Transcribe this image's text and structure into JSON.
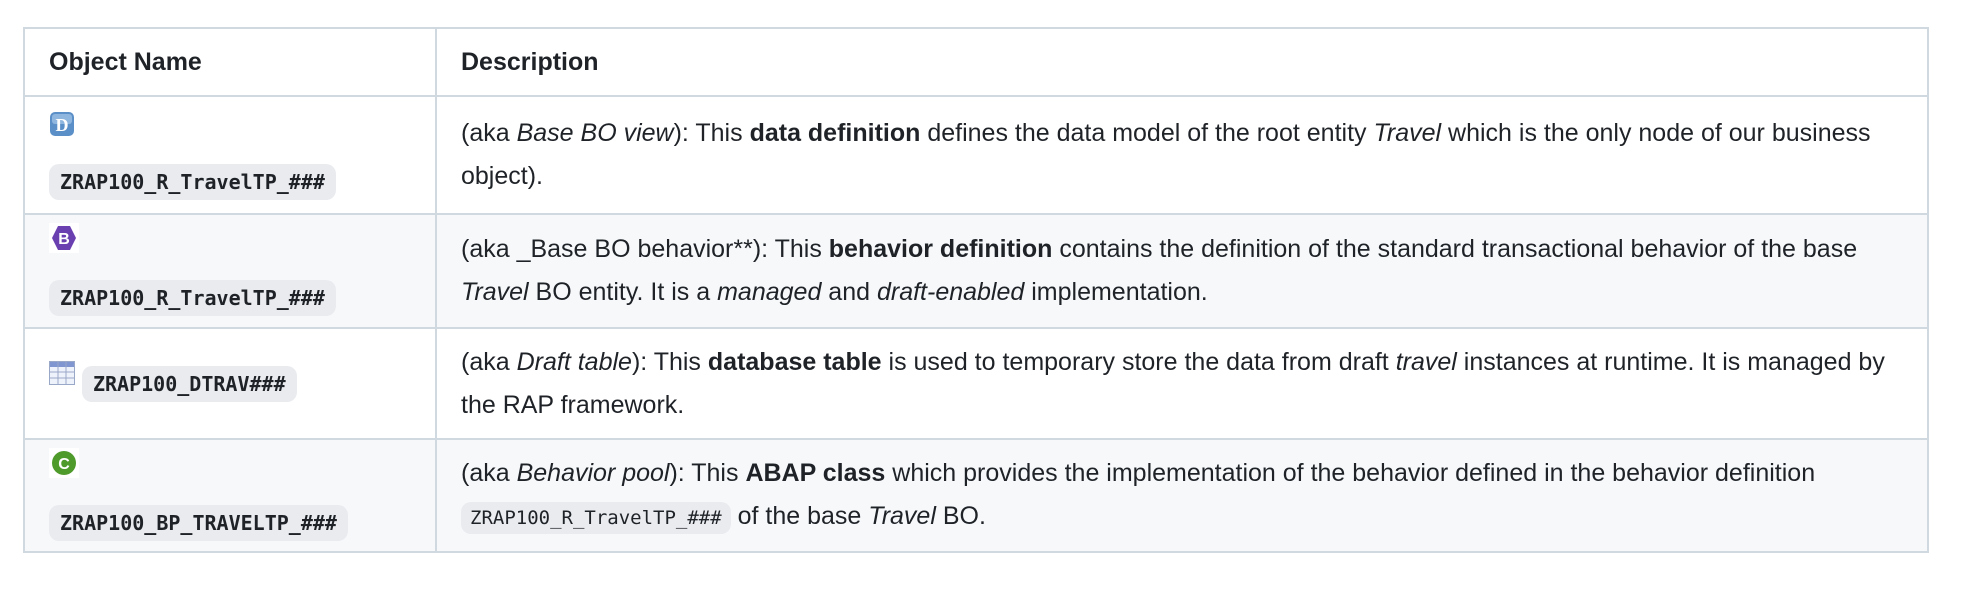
{
  "headers": {
    "object_name": "Object Name",
    "description": "Description"
  },
  "rows": [
    {
      "icon": "data-definition-icon",
      "name": "ZRAP100_R_TravelTP_###",
      "desc": [
        {
          "t": "(aka "
        },
        {
          "t": "Base BO view",
          "i": true
        },
        {
          "t": "): This "
        },
        {
          "t": "data definition",
          "b": true
        },
        {
          "t": " defines the data model of the root entity "
        },
        {
          "t": "Travel",
          "i": true
        },
        {
          "t": " which is the only node of our business object)."
        }
      ]
    },
    {
      "icon": "behavior-definition-icon",
      "name": "ZRAP100_R_TravelTP_###",
      "desc": [
        {
          "t": "(aka _Base BO behavior**): This "
        },
        {
          "t": "behavior definition",
          "b": true
        },
        {
          "t": " contains the definition of the standard transactional behavior of the base "
        },
        {
          "t": "Travel",
          "i": true
        },
        {
          "t": " BO entity. It is a "
        },
        {
          "t": "managed",
          "i": true
        },
        {
          "t": " and "
        },
        {
          "t": "draft-enabled",
          "i": true
        },
        {
          "t": " implementation."
        }
      ]
    },
    {
      "icon": "database-table-icon",
      "name": "ZRAP100_DTRAV###",
      "desc": [
        {
          "t": "(aka "
        },
        {
          "t": "Draft table",
          "i": true
        },
        {
          "t": "): This "
        },
        {
          "t": "database table",
          "b": true
        },
        {
          "t": " is used to temporary store the data from draft "
        },
        {
          "t": "travel",
          "i": true
        },
        {
          "t": " instances at runtime. It is managed by the RAP framework."
        }
      ]
    },
    {
      "icon": "abap-class-icon",
      "name": "ZRAP100_BP_TRAVELTP_###",
      "desc": [
        {
          "t": "(aka "
        },
        {
          "t": "Behavior pool",
          "i": true
        },
        {
          "t": "): This "
        },
        {
          "t": "ABAP class",
          "b": true
        },
        {
          "t": " which provides the implementation of the behavior defined in the behavior definition "
        },
        {
          "t": "ZRAP100_R_TravelTP_###",
          "c": true
        },
        {
          "t": " of the base "
        },
        {
          "t": "Travel",
          "i": true
        },
        {
          "t": " BO."
        }
      ]
    }
  ]
}
